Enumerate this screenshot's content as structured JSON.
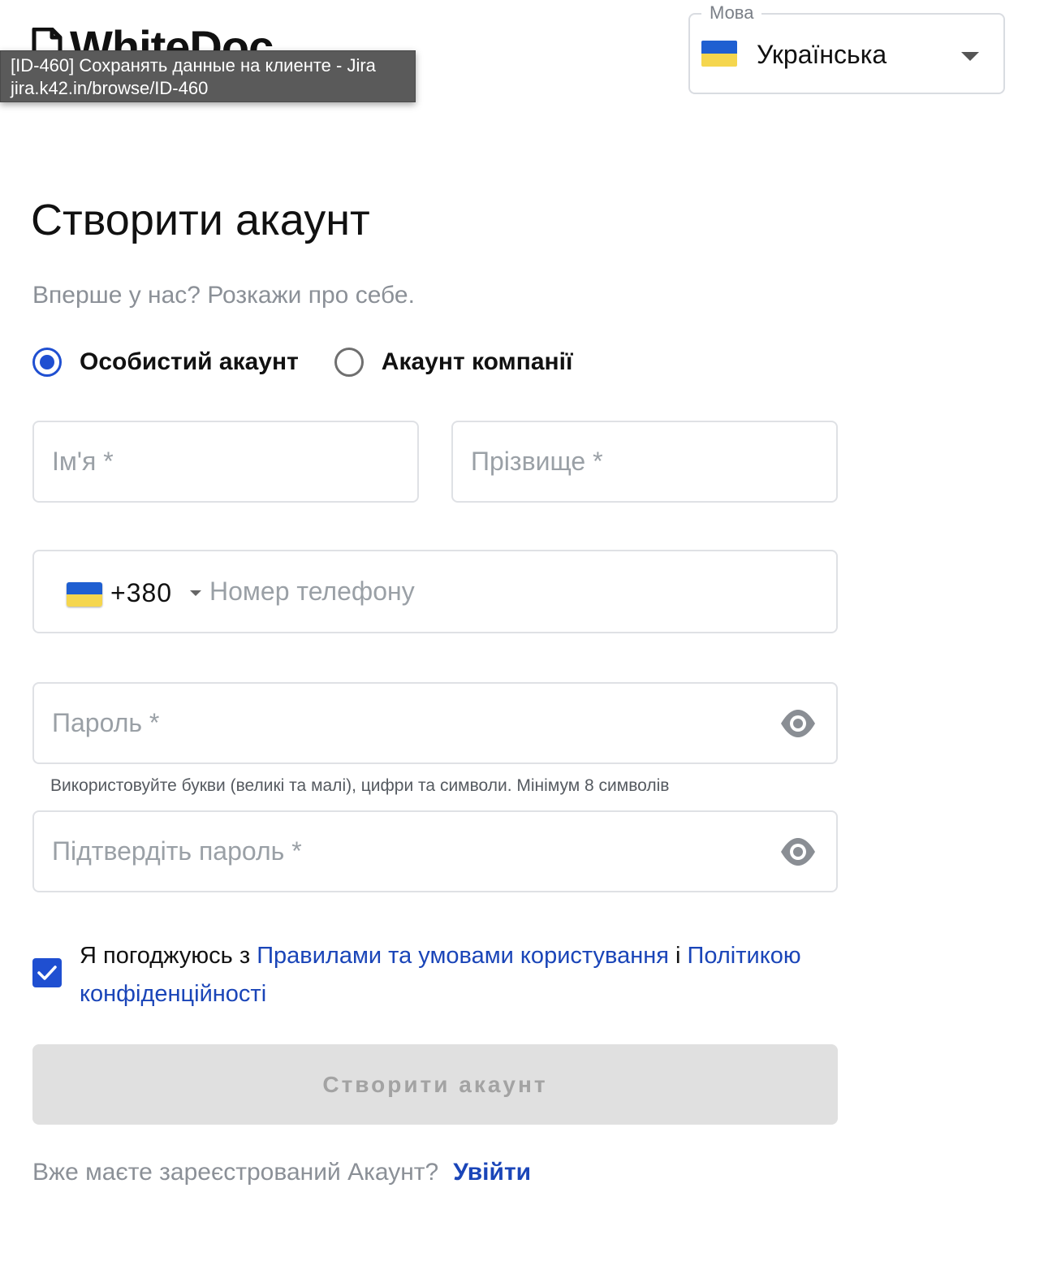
{
  "brand": {
    "logo_text": "WhiteDoc"
  },
  "tooltip": {
    "title": "[ID-460] Сохранять данные на клиенте - Jira",
    "url": "jira.k42.in/browse/ID-460"
  },
  "language": {
    "label": "Мова",
    "value": "Українська",
    "flag_colors": [
      "#1f5fd1",
      "#f5d64e"
    ]
  },
  "form": {
    "title": "Створити акаунт",
    "subtitle": "Вперше у нас? Розкажи про себе.",
    "account_types": [
      {
        "label": "Особистий акаунт",
        "selected": true
      },
      {
        "label": "Акаунт компанії",
        "selected": false
      }
    ],
    "first_name": {
      "placeholder": "Ім'я *",
      "value": ""
    },
    "last_name": {
      "placeholder": "Прізвище *",
      "value": ""
    },
    "phone": {
      "country_code": "+380",
      "placeholder": "Номер телефону",
      "value": ""
    },
    "password": {
      "placeholder": "Пароль *",
      "value": "",
      "hint": "Використовуйте букви (великі та малі), цифри та символи. Мінімум 8 символів"
    },
    "confirm_password": {
      "placeholder": "Підтвердіть пароль *",
      "value": ""
    },
    "consent": {
      "checked": true,
      "prefix": "Я погоджуюсь з ",
      "terms_link": "Правилами та умовами користування",
      "conjunction": " і ",
      "privacy_link": "Політикою конфіденційності"
    },
    "submit_label": "Створити акаунт"
  },
  "footer": {
    "question": "Вже маєте зареєстрований Акаунт?",
    "login_link": "Увійти"
  },
  "colors": {
    "accent": "#1f4fd1",
    "link": "#1a45b8",
    "disabled_button_bg": "#e0e0e0",
    "disabled_button_text": "#a3a3a3"
  }
}
